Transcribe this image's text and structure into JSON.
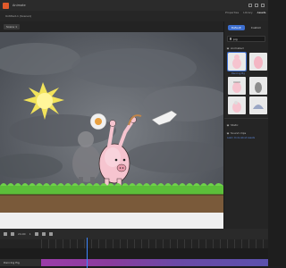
{
  "app": {
    "title": "Animate"
  },
  "header": {
    "doc_title": "Untitled-1 (Scene1)"
  },
  "right_tabs": [
    "Properties",
    "Library",
    "Assets"
  ],
  "toolbar": {
    "scene_label": "Scene 1"
  },
  "assets_panel": {
    "tabs": [
      "Default",
      "Custom"
    ],
    "active_tab": "Default",
    "search_value": "pig",
    "section_animated": "Animated",
    "thumb_caption": "Dancing Pig",
    "section_static": "Static",
    "section_sound": "Sound clips",
    "link_text": "Learn more about assets"
  },
  "timeline": {
    "fps": "24.00",
    "frame": "1",
    "layer_name": "Dancing Pig"
  },
  "colors": {
    "accent": "#3d6fd0",
    "playhead": "#3d86ff",
    "clip_start": "#9b3da8",
    "clip_end": "#5b51ad"
  }
}
